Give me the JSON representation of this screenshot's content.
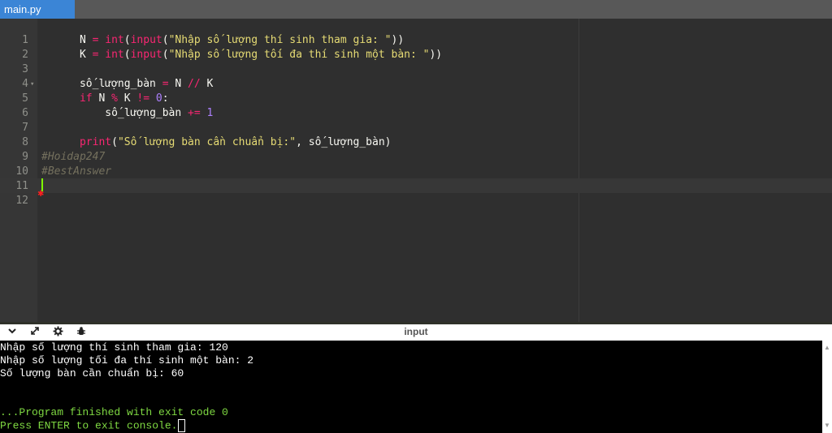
{
  "tab": {
    "filename": "main.py"
  },
  "editor": {
    "lines": [
      {
        "n": "1"
      },
      {
        "n": "2"
      },
      {
        "n": "3"
      },
      {
        "n": "4"
      },
      {
        "n": "5"
      },
      {
        "n": "6"
      },
      {
        "n": "7"
      },
      {
        "n": "8"
      },
      {
        "n": "9"
      },
      {
        "n": "10"
      },
      {
        "n": "11"
      },
      {
        "n": "12"
      }
    ],
    "code": {
      "l1_var": "N",
      "l1_eq": " = ",
      "l1_int": "int",
      "l1_p1": "(",
      "l1_input": "input",
      "l1_p2": "(",
      "l1_str": "\"Nhập số lượng thí sinh tham gia: \"",
      "l1_close": "))",
      "l2_var": "K",
      "l2_eq": " = ",
      "l2_int": "int",
      "l2_p1": "(",
      "l2_input": "input",
      "l2_p2": "(",
      "l2_str": "\"Nhập số lượng tối đa thí sinh một bàn: \"",
      "l2_close": "))",
      "l4_var": "số_lượng_bàn",
      "l4_eq": " = ",
      "l4_rest": "N ",
      "l4_op": "//",
      "l4_k": " K",
      "l5_if": "if",
      "l5_n": " N ",
      "l5_mod": "%",
      "l5_k": " K ",
      "l5_ne": "!=",
      "l5_sp": " ",
      "l5_zero": "0",
      "l5_colon": ":",
      "l6_indent": "    ",
      "l6_var": "số_lượng_bàn",
      "l6_sp": " ",
      "l6_op": "+=",
      "l6_sp2": " ",
      "l6_one": "1",
      "l8_print": "print",
      "l8_p": "(",
      "l8_str": "\"Số lượng bàn cần chuẩn bị:\"",
      "l8_rest": ", số_lượng_bàn)",
      "l10_comment": "#Hoidap247",
      "l11_comment": "#BestAnswer"
    }
  },
  "console_toolbar": {
    "title": "input",
    "icons": [
      "chevron-down-icon",
      "expand-icon",
      "gear-icon",
      "debug-icon"
    ]
  },
  "console": {
    "lines": [
      "Nhập số lượng thí sinh tham gia: 120",
      "Nhập số lượng tối đa thí sinh một bàn: 2",
      "Số lượng bàn cần chuẩn bị: 60",
      "",
      "",
      "...Program finished with exit code 0",
      "Press ENTER to exit console."
    ]
  },
  "colors": {
    "tab_active": "#3b85d6",
    "console_green": "#7fd942",
    "keyword": "#f92672",
    "string": "#e6db74",
    "number": "#ae81ff",
    "comment": "#75715e"
  }
}
